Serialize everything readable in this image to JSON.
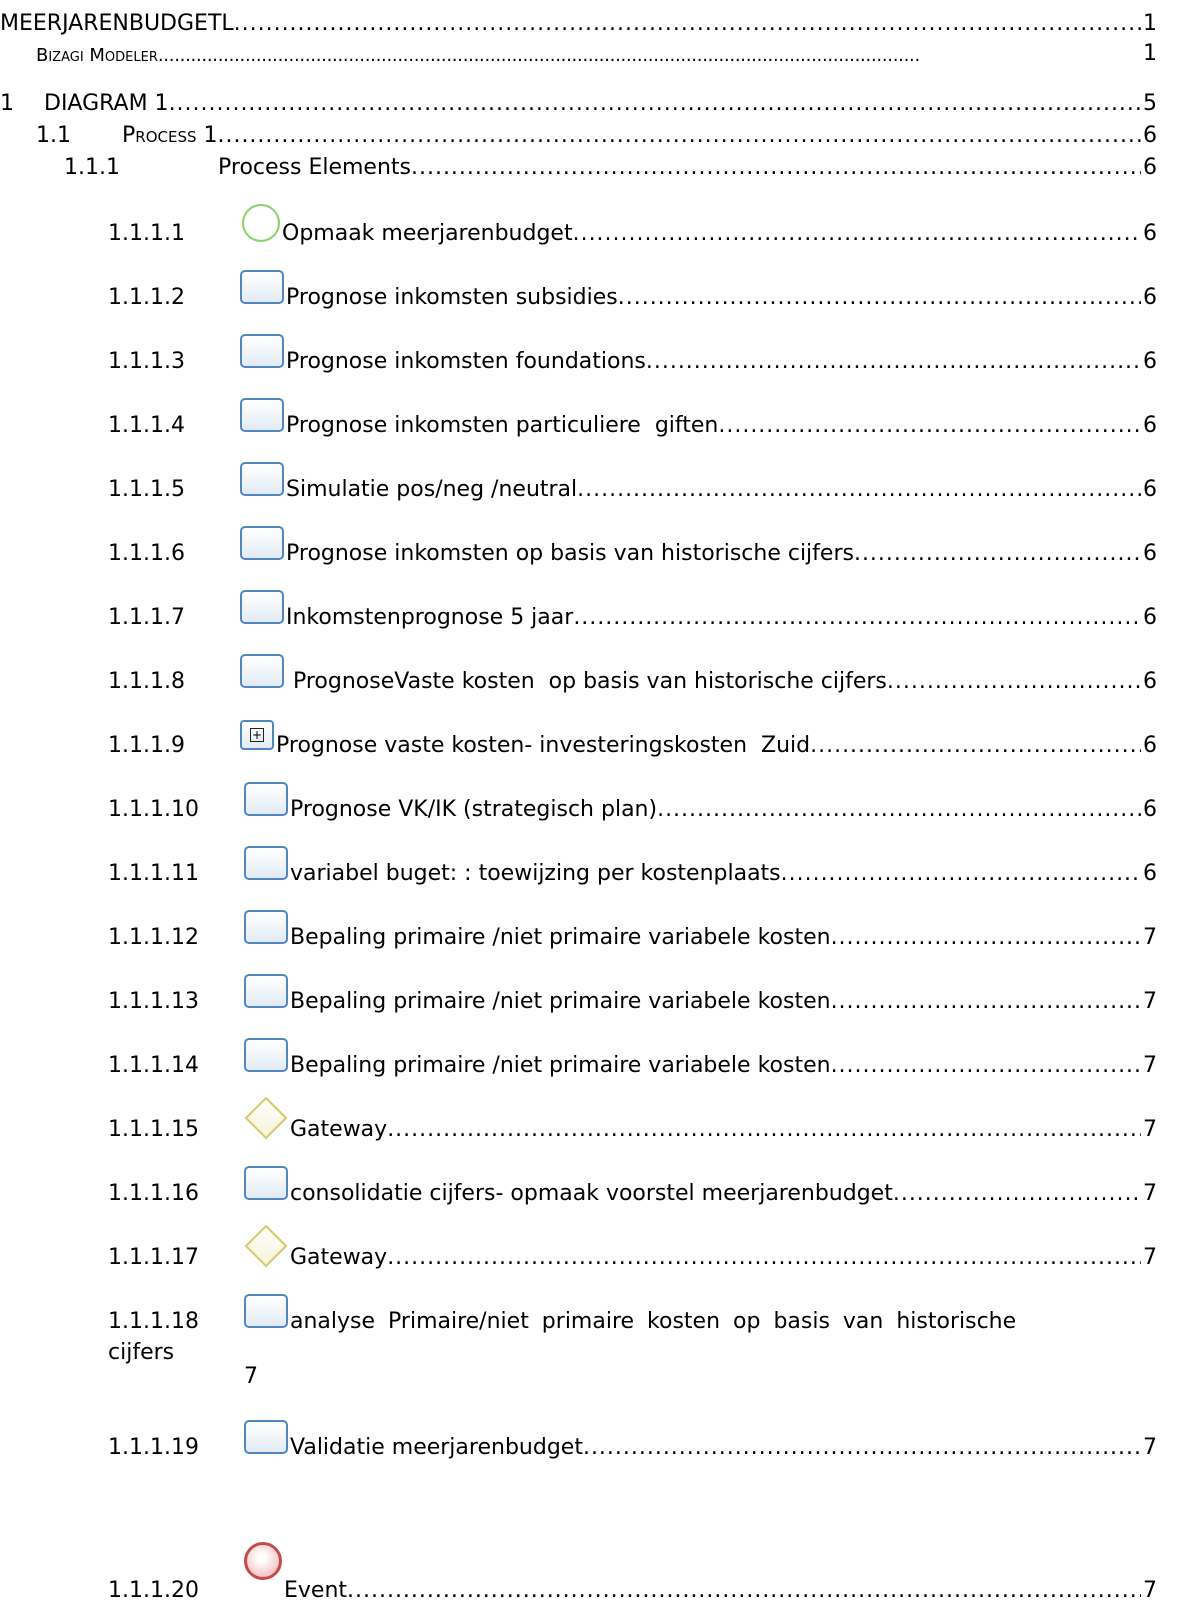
{
  "toc": [
    {
      "level": "h1",
      "num": "",
      "title": "MEERJARENBUDGETL",
      "page": "1"
    },
    {
      "level": "h1sub",
      "num": "",
      "title": "Bizagi Modeler",
      "page": "1"
    },
    {
      "level": "h2",
      "num": "1",
      "title": "DIAGRAM 1",
      "page": "5"
    },
    {
      "level": "h3",
      "num": "1.1",
      "title": "Process 1",
      "page": "6"
    },
    {
      "level": "h4",
      "num": "1.1.1",
      "title": "Process Elements",
      "page": "6"
    },
    {
      "level": "h5",
      "num": "1.1.1.1",
      "icon": "start-event",
      "title": "Opmaak meerjarenbudget",
      "page": "6"
    },
    {
      "level": "h5",
      "num": "1.1.1.2",
      "icon": "task",
      "title": "Prognose inkomsten subsidies",
      "page": "6"
    },
    {
      "level": "h5",
      "num": "1.1.1.3",
      "icon": "task",
      "title": "Prognose inkomsten foundations",
      "page": "6"
    },
    {
      "level": "h5",
      "num": "1.1.1.4",
      "icon": "task",
      "title": "Prognose inkomsten particuliere  giften",
      "page": "6"
    },
    {
      "level": "h5",
      "num": "1.1.1.5",
      "icon": "task",
      "title": "Simulatie pos/neg /neutral",
      "page": "6"
    },
    {
      "level": "h5",
      "num": "1.1.1.6",
      "icon": "task",
      "title": "Prognose inkomsten op basis van historische cijfers",
      "page": "6"
    },
    {
      "level": "h5",
      "num": "1.1.1.7",
      "icon": "task",
      "title": "Inkomstenprognose 5 jaar",
      "page": "6"
    },
    {
      "level": "h5",
      "num": "1.1.1.8",
      "icon": "task",
      "title": " PrognoseVaste kosten  op basis van historische cijfers",
      "page": "6"
    },
    {
      "level": "h5",
      "num": "1.1.1.9",
      "icon": "subprocess",
      "title": "Prognose vaste kosten- investeringskosten  Zuid",
      "page": "6"
    },
    {
      "level": "h5",
      "num": "1.1.1.10",
      "icon": "task",
      "title": "Prognose VK/IK (strategisch plan)",
      "page": "6"
    },
    {
      "level": "h5",
      "num": "1.1.1.11",
      "icon": "task",
      "title": "variabel buget: : toewijzing per kostenplaats",
      "page": "6"
    },
    {
      "level": "h5",
      "num": "1.1.1.12",
      "icon": "task",
      "title": "Bepaling primaire /niet primaire variabele kosten",
      "page": "7"
    },
    {
      "level": "h5",
      "num": "1.1.1.13",
      "icon": "task",
      "title": "Bepaling primaire /niet primaire variabele kosten",
      "page": "7"
    },
    {
      "level": "h5",
      "num": "1.1.1.14",
      "icon": "task",
      "title": "Bepaling primaire /niet primaire variabele kosten",
      "page": "7"
    },
    {
      "level": "h5",
      "num": "1.1.1.15",
      "icon": "gateway",
      "title": "Gateway",
      "page": "7"
    },
    {
      "level": "h5",
      "num": "1.1.1.16",
      "icon": "task",
      "title": "consolidatie cijfers- opmaak voorstel meerjarenbudget",
      "page": "7"
    },
    {
      "level": "h5",
      "num": "1.1.1.17",
      "icon": "gateway",
      "title": "Gateway",
      "page": "7"
    },
    {
      "level": "h5wrap",
      "num": "1.1.1.18",
      "icon": "task",
      "title": "analyse Primaire/niet primaire kosten op basis van historische",
      "title_cont": "cijfers",
      "page": "7"
    },
    {
      "level": "h5",
      "num": "1.1.1.19",
      "icon": "task",
      "title": "Validatie meerjarenbudget",
      "page": "7"
    },
    {
      "level": "h5",
      "num": "1.1.1.20",
      "icon": "end-event",
      "title": "Event",
      "page": "7"
    }
  ]
}
